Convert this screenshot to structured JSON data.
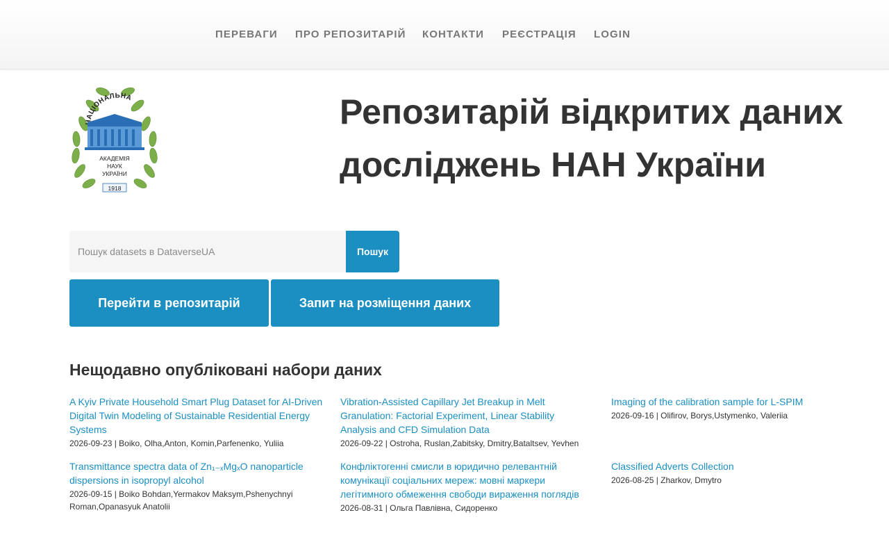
{
  "nav": {
    "items": [
      "ПЕРЕВАГИ",
      "ПРО РЕПОЗИТАРІЙ",
      "КОНТАКТИ",
      "РЕЄСТРАЦІЯ",
      "LOGIN"
    ]
  },
  "logo": {
    "arc_text": "НАЦІОНАЛЬНА",
    "line1": "АКАДЕМІЯ",
    "line2": "НАУК",
    "line3": "УКРАЇНИ",
    "year": "1918"
  },
  "hero": {
    "title_line1": "Репозитарій відкритих даних",
    "title_line2": "досліджень НАН України"
  },
  "search": {
    "placeholder": "Пошук datasets в DataverseUA",
    "value": "",
    "button_label": "Пошук"
  },
  "actions": {
    "go_repo_label": "Перейти в репозитарій",
    "request_label": "Запит на розміщення даних"
  },
  "recent": {
    "heading": "Нещодавно опубліковані набори даних",
    "items": [
      {
        "title": "A Kyiv Private Household Smart Plug Dataset for AI-Driven Digital Twin Modeling of Sustainable Residential Energy Systems",
        "meta": "2026-09-23 | Boiko, Olha,Anton, Komin,Parfenenko, Yuliia"
      },
      {
        "title": "Vibration-Assisted Capillary Jet Breakup in Melt Granulation: Factorial Experiment, Linear Stability Analysis and CFD Simulation Data",
        "meta": "2026-09-22 | Ostroha, Ruslan,Zabitsky, Dmitry,Bataltsev, Yevhen"
      },
      {
        "title": "Imaging of the calibration sample for L-SPIM",
        "meta": "2026-09-16 | Olifirov, Borys,Ustymenko, Valeriia"
      },
      {
        "title": "Transmittance spectra data of Zn₁₋ₓMgₓO nanoparticle dispersions in isopropyl alcohol",
        "meta": "2026-09-15 | Boiko Bohdan,Yermakov Maksym,Pshenychnyi Roman,Opanasyuk Anatolii"
      },
      {
        "title": "Конфліктогенні смисли в юридично релевантній комунікації соціальних мереж: мовні маркери легітимного обмеження свободи вираження поглядів",
        "meta": "2026-08-31 | Ольга Павлівна, Сидоренко"
      },
      {
        "title": "Classified Adverts Collection",
        "meta": "2026-08-25 | Zharkov, Dmytro"
      }
    ]
  },
  "colors": {
    "accent": "#1b8fc2",
    "nav_text": "#777777",
    "text": "#333333",
    "logo_blue": "#2a6fb5",
    "logo_green": "#7cae4a"
  }
}
